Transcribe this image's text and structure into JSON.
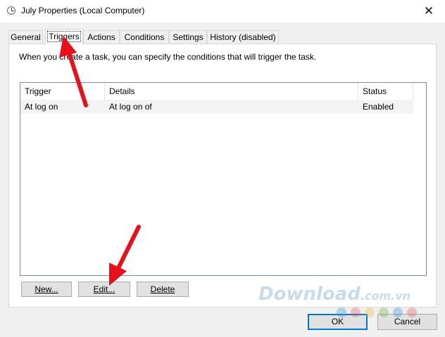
{
  "window": {
    "title": "July Properties (Local Computer)",
    "close_glyph": "✕"
  },
  "tabs": [
    {
      "label": "General",
      "active": false
    },
    {
      "label": "Triggers",
      "active": true
    },
    {
      "label": "Actions",
      "active": false
    },
    {
      "label": "Conditions",
      "active": false
    },
    {
      "label": "Settings",
      "active": false
    },
    {
      "label": "History (disabled)",
      "active": false
    }
  ],
  "triggers_panel": {
    "description": "When you create a task, you can specify the conditions that will trigger the task.",
    "columns": [
      "Trigger",
      "Details",
      "Status"
    ],
    "rows": [
      {
        "trigger": "At log on",
        "details": "At log on of",
        "status": "Enabled"
      }
    ],
    "buttons": {
      "new_label": "New...",
      "edit_label": "Edit...",
      "delete_label": "Delete"
    }
  },
  "footer": {
    "ok_label": "OK",
    "cancel_label": "Cancel"
  },
  "watermark": {
    "text": "Download",
    "suffix": ".com.vn"
  },
  "colors": {
    "annotation_arrow": "#e8101a",
    "default_button_border": "#0078d7",
    "dots": [
      "#3f93d2",
      "#e65a5a",
      "#f5b935",
      "#6fb84e",
      "#3f93d2",
      "#e65a5a"
    ]
  }
}
